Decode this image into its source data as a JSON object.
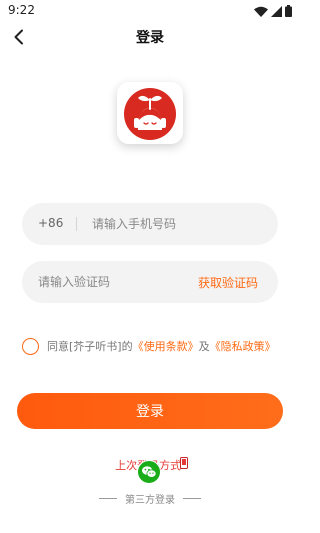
{
  "status_bar": {
    "time": "9:22",
    "icons": [
      "wifi-icon",
      "signal-icon",
      "battery-icon"
    ]
  },
  "header": {
    "title": "登录",
    "back_icon": "chevron-left-icon"
  },
  "logo": {
    "icon": "app-logo-sprout-face",
    "brand_color": "#d82a20"
  },
  "phone_field": {
    "country_code": "+86",
    "placeholder": "请输入手机号码",
    "value": ""
  },
  "code_field": {
    "placeholder": "请输入验证码",
    "value": "",
    "get_code_label": "获取验证码"
  },
  "agreement": {
    "checked": false,
    "prefix": "同意[芥子听书]的",
    "terms_label": "《使用条款》",
    "joiner": "及",
    "privacy_label": "《隐私政策》"
  },
  "login_button": {
    "label": "登录"
  },
  "last_login": {
    "label": "上次登录方式:",
    "method_icon": "wechat-icon"
  },
  "third_party": {
    "label": "第三方登录"
  },
  "colors": {
    "accent": "#ff6a14",
    "wechat": "#1aad19",
    "last_login_text": "#e53935"
  }
}
